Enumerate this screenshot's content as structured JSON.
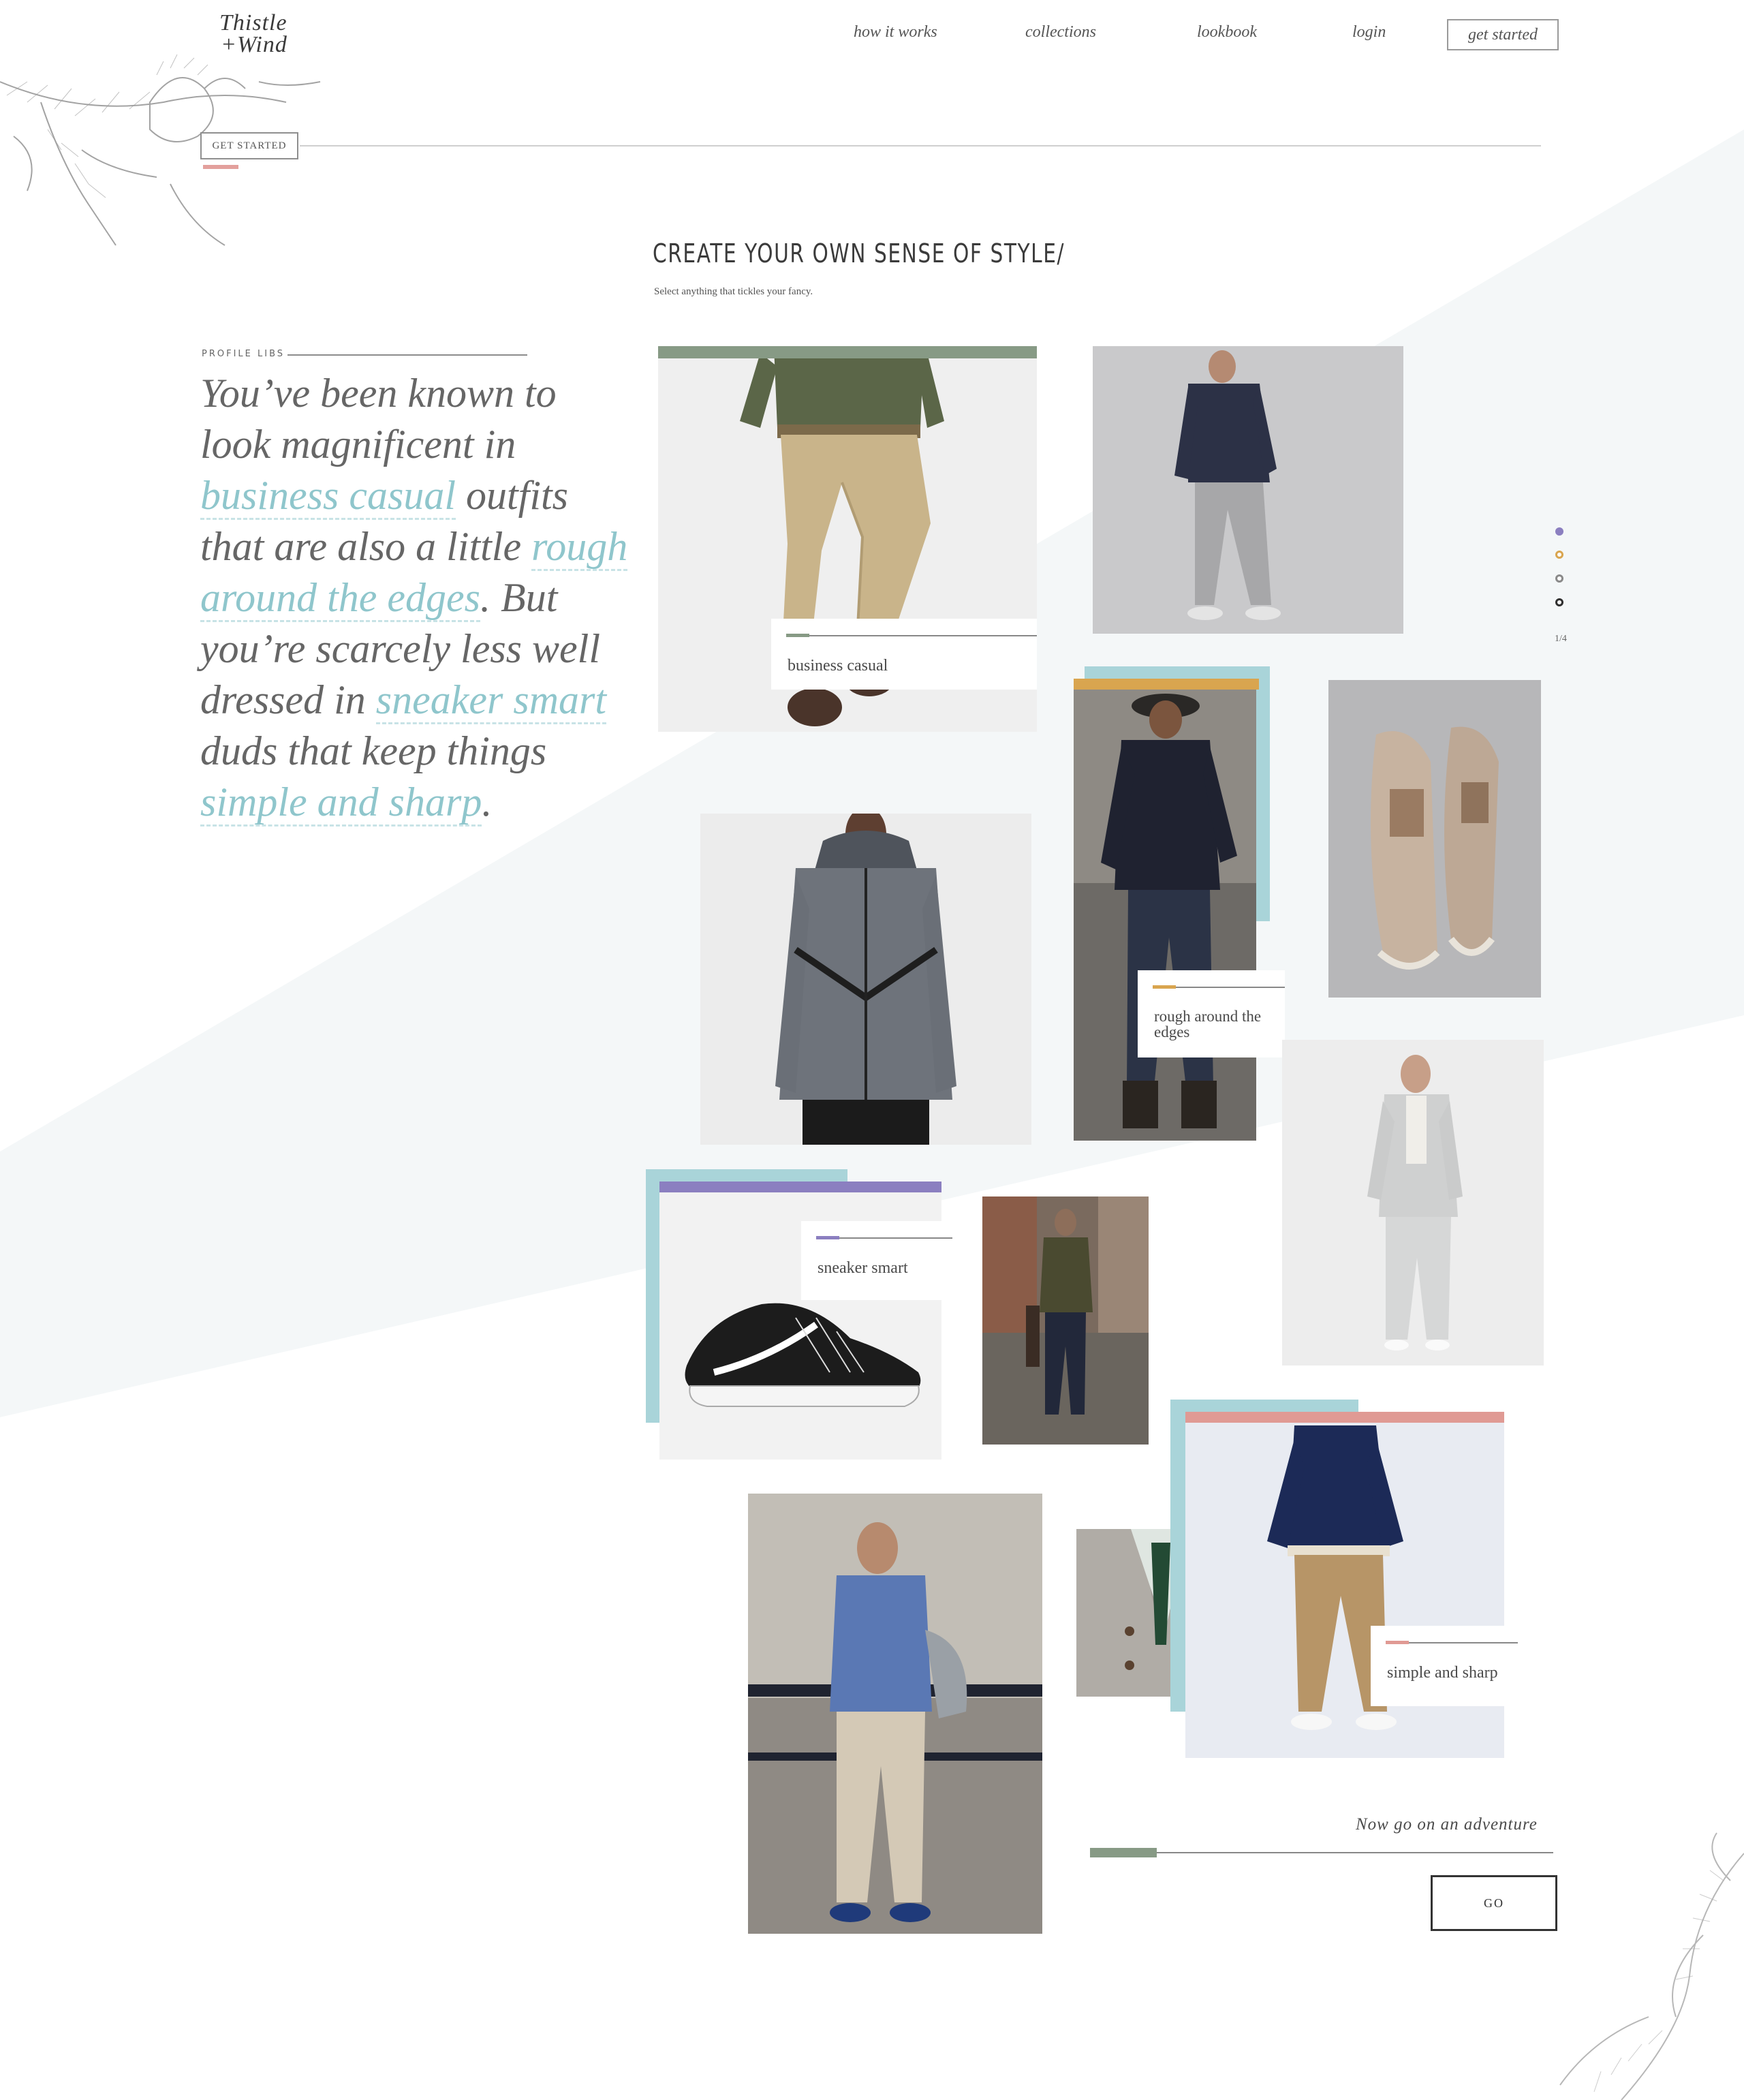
{
  "brand": {
    "line1": "Thistle",
    "line2": "+Wind"
  },
  "nav": {
    "items": [
      "how it works",
      "collections",
      "lookbook",
      "login"
    ],
    "cta": "get started"
  },
  "banner": {
    "button": "GET STARTED"
  },
  "intro": {
    "heading": "CREATE YOUR OWN SENSE OF STYLE/",
    "subheading": "Select anything that tickles your fancy."
  },
  "profile": {
    "label": "PROFILE LIBS",
    "segments": [
      {
        "text": "You’ve been known to look magnificent in ",
        "highlight": false
      },
      {
        "text": "business casual",
        "highlight": true
      },
      {
        "text": " outfits that are also a little ",
        "highlight": false
      },
      {
        "text": "rough around the edges",
        "highlight": true
      },
      {
        "text": ". But you’re scarcely less well dressed in ",
        "highlight": false
      },
      {
        "text": "sneaker smart",
        "highlight": true
      },
      {
        "text": " duds that keep things ",
        "highlight": false
      },
      {
        "text": "simple and sharp",
        "highlight": true
      },
      {
        "text": ".",
        "highlight": false
      }
    ]
  },
  "styles": [
    {
      "label": "business casual",
      "color": "#879a85"
    },
    {
      "label": "rough around the edges",
      "color": "#d9a54f"
    },
    {
      "label": "sneaker smart",
      "color": "#8b7fc0"
    },
    {
      "label": "simple and sharp",
      "color": "#e09a94"
    }
  ],
  "pager": {
    "text": "1/4"
  },
  "cta": {
    "prompt": "Now go on an adventure",
    "button": "GO"
  },
  "colors": {
    "teal": "#a9d4d9",
    "highlight": "#8fc6cc",
    "photoBg": "#ececec"
  }
}
